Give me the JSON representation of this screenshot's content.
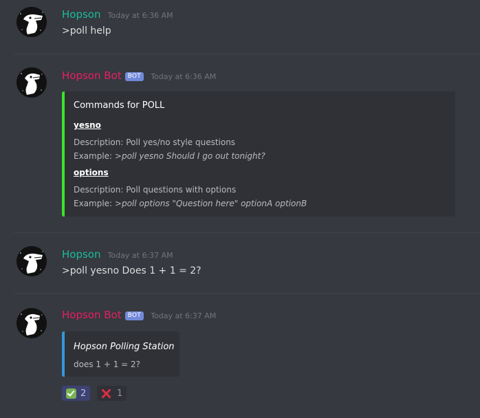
{
  "messages": [
    {
      "username": "Hopson",
      "timestamp": "Today at 6:36 AM",
      "text": ">poll help"
    },
    {
      "username": "Hopson Bot",
      "bot_tag": "BOT",
      "timestamp": "Today at 6:36 AM",
      "embed": {
        "title": "Commands for POLL",
        "accent_color": "#3ae52a",
        "fields": [
          {
            "name": "yesno",
            "description_label": "Description: ",
            "description": "Poll yes/no style questions",
            "example_label": "Example: ",
            "example": ">poll yesno Should I go out tonight?"
          },
          {
            "name": "options",
            "description_label": "Description: ",
            "description": "Poll questions with options",
            "example_label": "Example: ",
            "example": ">poll options \"Question here\" optionA optionB"
          }
        ]
      }
    },
    {
      "username": "Hopson",
      "timestamp": "Today at 6:37 AM",
      "text": ">poll yesno Does 1 + 1 = 2?"
    },
    {
      "username": "Hopson Bot",
      "bot_tag": "BOT",
      "timestamp": "Today at 6:37 AM",
      "embed": {
        "title": "Hopson Polling Station",
        "body": "does 1 + 1 = 2?",
        "accent_color": "#3498db"
      },
      "reactions": [
        {
          "emoji": "white-check-mark-icon",
          "count": "2",
          "selected": true
        },
        {
          "emoji": "cross-mark-icon",
          "count": "1",
          "selected": false
        }
      ]
    }
  ],
  "colors": {
    "background": "#36393f",
    "hopson_name": "#1abc9c",
    "bot_name": "#e91e63",
    "bot_tag": "#7289da"
  }
}
